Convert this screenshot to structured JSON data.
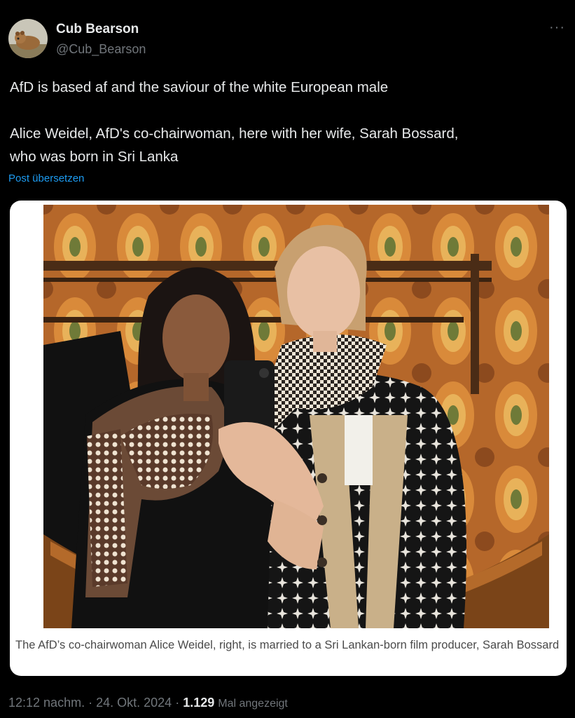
{
  "author": {
    "display_name": "Cub Bearson",
    "handle": "@Cub_Bearson"
  },
  "more_label": "···",
  "tweet": {
    "line1": "AfD is based af and the saviour of the white European male",
    "line2": "Alice Weidel, AfD's co-chairwoman, here with her wife, Sarah Bossard,",
    "line3": "who was born in Sri Lanka"
  },
  "translate_label": "Post übersetzen",
  "media": {
    "caption": "The AfD’s co-chairwoman Alice Weidel, right, is married to a Sri Lankan-born film producer, Sarah Bossard"
  },
  "meta": {
    "time": "12:12 nachm.",
    "date": "24. Okt. 2024",
    "views_count": "1.129",
    "views_label": "Mal angezeigt"
  },
  "colors": {
    "background": "#000000",
    "text": "#e7e9ea",
    "secondary": "#71767b",
    "link": "#1d9bf0"
  }
}
